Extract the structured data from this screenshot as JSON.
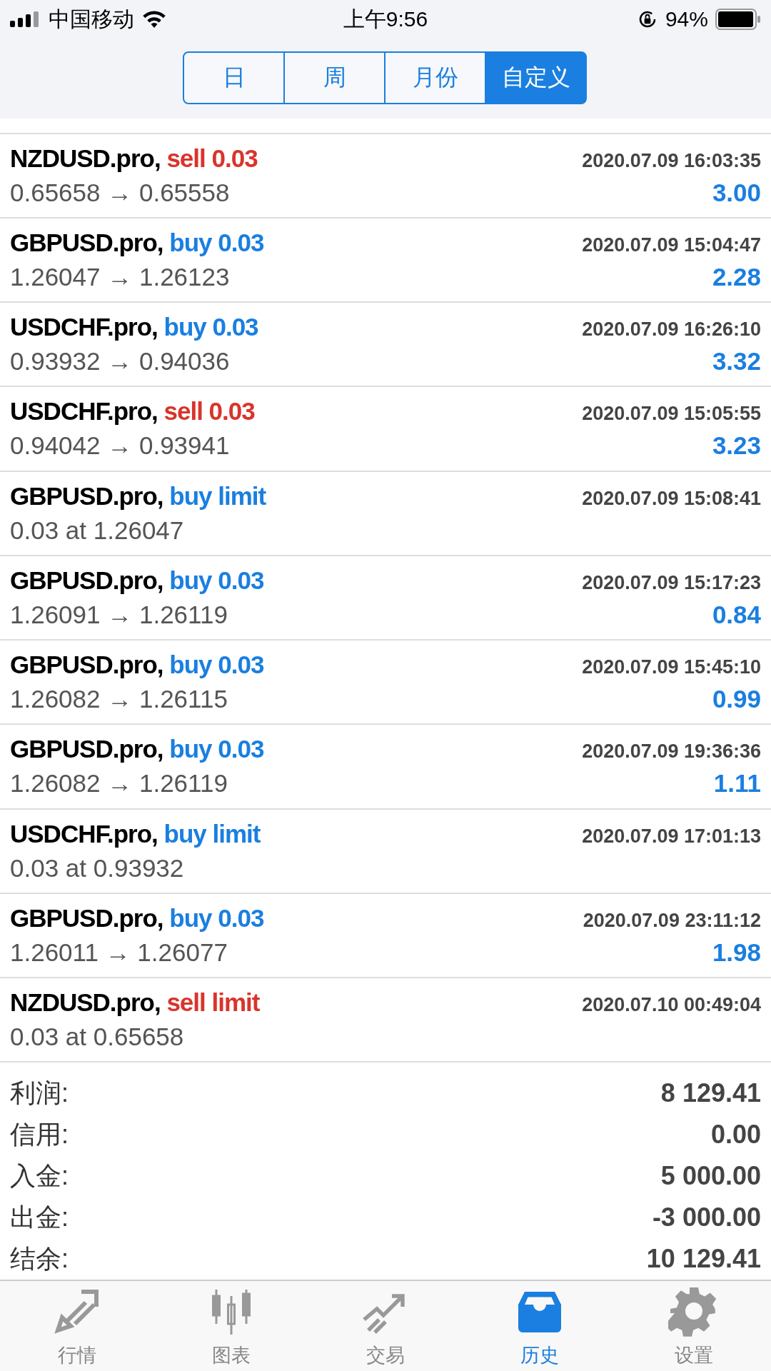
{
  "status_bar": {
    "carrier": "中国移动",
    "time": "上午9:56",
    "battery": "94%"
  },
  "period_tabs": [
    {
      "label": "日",
      "selected": false
    },
    {
      "label": "周",
      "selected": false
    },
    {
      "label": "月份",
      "selected": false
    },
    {
      "label": "自定义",
      "selected": true
    }
  ],
  "trades": [
    {
      "symbol": "NZDUSD.pro,",
      "kind": "sell",
      "action": "sell 0.03",
      "time": "2020.07.09 16:03:35",
      "prices": "0.65658 → 0.65558",
      "profit": "3.00"
    },
    {
      "symbol": "GBPUSD.pro,",
      "kind": "buy",
      "action": "buy 0.03",
      "time": "2020.07.09 15:04:47",
      "prices": "1.26047 → 1.26123",
      "profit": "2.28"
    },
    {
      "symbol": "USDCHF.pro,",
      "kind": "buy",
      "action": "buy 0.03",
      "time": "2020.07.09 16:26:10",
      "prices": "0.93932 → 0.94036",
      "profit": "3.32"
    },
    {
      "symbol": "USDCHF.pro,",
      "kind": "sell",
      "action": "sell 0.03",
      "time": "2020.07.09 15:05:55",
      "prices": "0.94042 → 0.93941",
      "profit": "3.23"
    },
    {
      "symbol": "GBPUSD.pro,",
      "kind": "buy",
      "action": "buy limit",
      "time": "2020.07.09 15:08:41",
      "prices": "0.03 at 1.26047"
    },
    {
      "symbol": "GBPUSD.pro,",
      "kind": "buy",
      "action": "buy 0.03",
      "time": "2020.07.09 15:17:23",
      "prices": "1.26091 → 1.26119",
      "profit": "0.84"
    },
    {
      "symbol": "GBPUSD.pro,",
      "kind": "buy",
      "action": "buy 0.03",
      "time": "2020.07.09 15:45:10",
      "prices": "1.26082 → 1.26115",
      "profit": "0.99"
    },
    {
      "symbol": "GBPUSD.pro,",
      "kind": "buy",
      "action": "buy 0.03",
      "time": "2020.07.09 19:36:36",
      "prices": "1.26082 → 1.26119",
      "profit": "1.11"
    },
    {
      "symbol": "USDCHF.pro,",
      "kind": "buy",
      "action": "buy limit",
      "time": "2020.07.09 17:01:13",
      "prices": "0.03 at 0.93932"
    },
    {
      "symbol": "GBPUSD.pro,",
      "kind": "buy",
      "action": "buy 0.03",
      "time": "2020.07.09 23:11:12",
      "prices": "1.26011 → 1.26077",
      "profit": "1.98"
    },
    {
      "symbol": "NZDUSD.pro,",
      "kind": "sell",
      "action": "sell limit",
      "time": "2020.07.10 00:49:04",
      "prices": "0.03 at 0.65658"
    }
  ],
  "summary": [
    {
      "label": "利润:",
      "value": "8 129.41"
    },
    {
      "label": "信用:",
      "value": "0.00"
    },
    {
      "label": "入金:",
      "value": "5 000.00"
    },
    {
      "label": "出金:",
      "value": "-3 000.00"
    },
    {
      "label": "结余:",
      "value": "10 129.41"
    }
  ],
  "tab_bar": [
    {
      "label": "行情",
      "kind": "quotes",
      "selected": false
    },
    {
      "label": "图表",
      "kind": "chart",
      "selected": false
    },
    {
      "label": "交易",
      "kind": "trade",
      "selected": false
    },
    {
      "label": "历史",
      "kind": "history",
      "selected": true
    },
    {
      "label": "设置",
      "kind": "settings",
      "selected": false
    }
  ]
}
